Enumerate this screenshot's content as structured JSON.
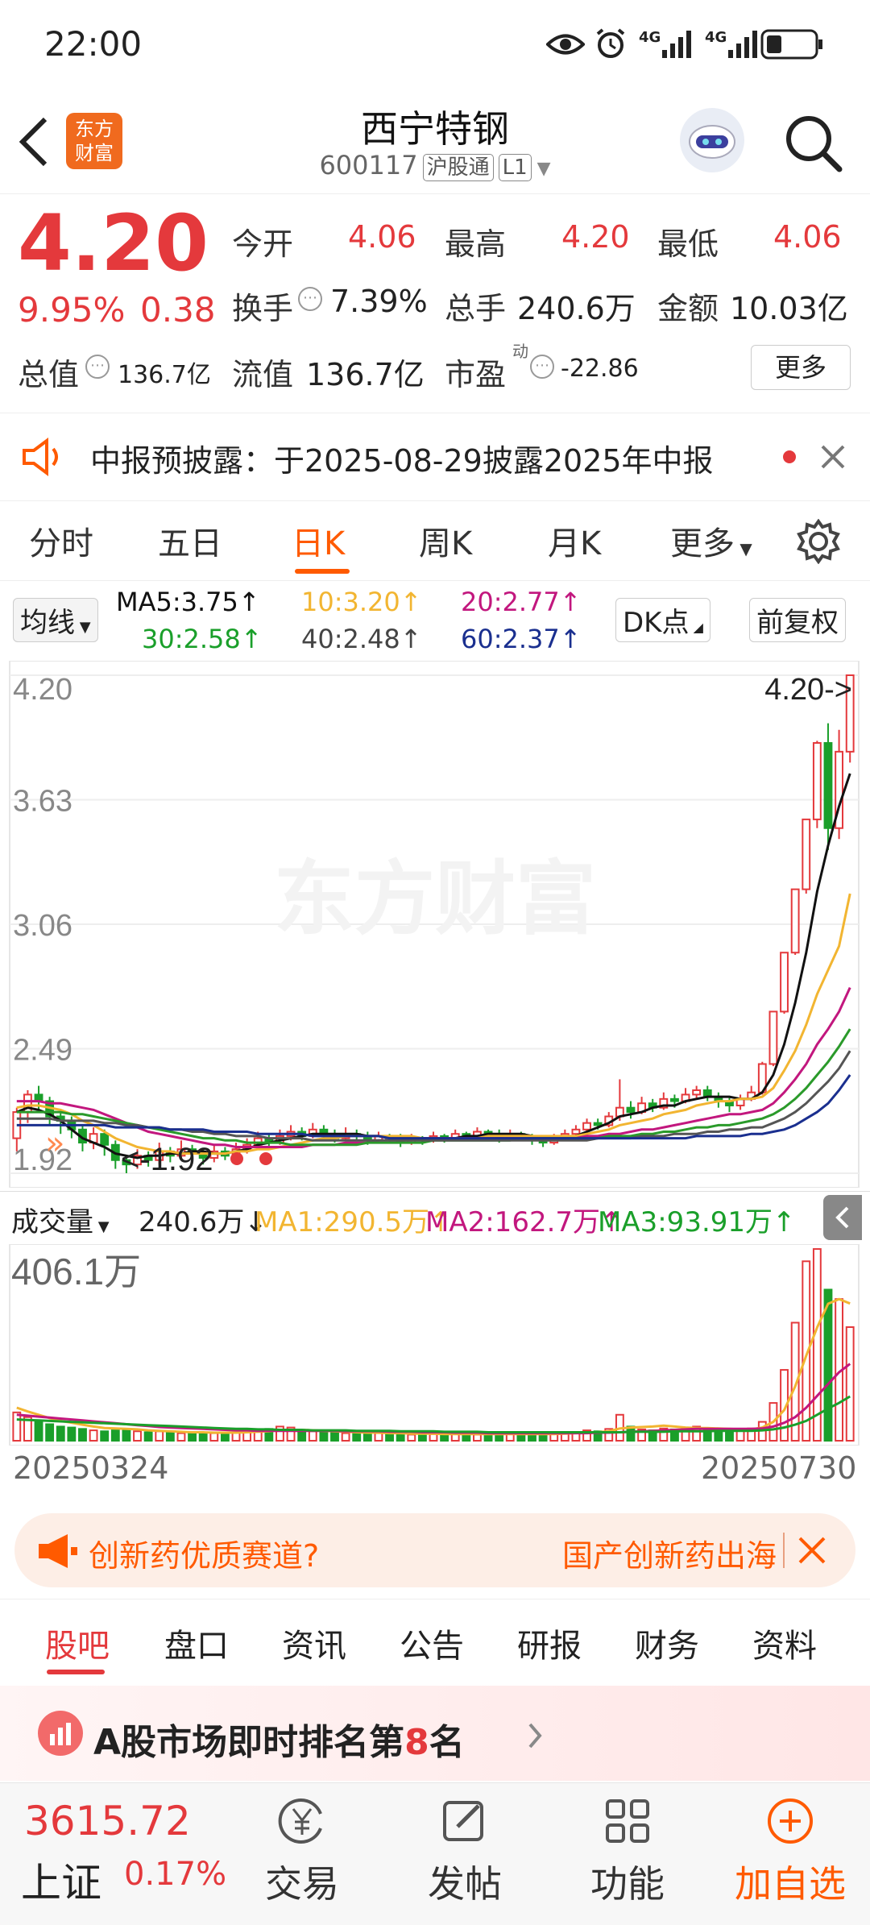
{
  "status_bar": {
    "time": "22:00",
    "net1": "4G",
    "net2": "4G"
  },
  "header": {
    "title": "西宁特钢",
    "code": "600117",
    "tag1": "沪股通",
    "tag2": "L1",
    "logo_line1": "东方",
    "logo_line2": "财富"
  },
  "quote": {
    "price": "4.20",
    "pct": "9.95%",
    "change": "0.38",
    "open_label": "今开",
    "open": "4.06",
    "high_label": "最高",
    "high": "4.20",
    "low_label": "最低",
    "low": "4.06",
    "turnover_label": "换手",
    "turnover": "7.39%",
    "volume_label": "总手",
    "volume": "240.6万",
    "amount_label": "金额",
    "amount": "10.03亿",
    "mktcap_label": "总值",
    "mktcap": "136.7亿",
    "float_label": "流值",
    "float": "136.7亿",
    "pe_label": "市盈",
    "pe_sup": "动",
    "pe": "-22.86",
    "more": "更多"
  },
  "notice": {
    "text": "中报预披露：于2025-08-29披露2025年中报"
  },
  "ktabs": [
    "分时",
    "五日",
    "日K",
    "周K",
    "月K",
    "更多"
  ],
  "ma": {
    "select": "均线",
    "ma5": "MA5:3.75↑",
    "ma10": "10:3.20↑",
    "ma20": "20:2.77↑",
    "ma30": "30:2.58↑",
    "ma40": "40:2.48↑",
    "ma60": "60:2.37↑",
    "dk": "DK点",
    "fq": "前复权"
  },
  "chart_data": {
    "type": "candlestick",
    "y_ticks": [
      "4.20",
      "3.63",
      "3.06",
      "2.49",
      "1.92"
    ],
    "ylim": [
      1.92,
      4.2
    ],
    "high_marker": "4.20->",
    "low_marker": "<-1.92",
    "watermark": "东方财富",
    "series": [
      {
        "name": "MA5",
        "color": "#111111"
      },
      {
        "name": "MA10",
        "color": "#f2b531"
      },
      {
        "name": "MA20",
        "color": "#c2177e"
      },
      {
        "name": "MA30",
        "color": "#2a9a2a"
      },
      {
        "name": "MA40",
        "color": "#555555"
      },
      {
        "name": "MA60",
        "color": "#1a2f8f"
      }
    ],
    "candles": [
      [
        2.08,
        2.2,
        2.22,
        2.02
      ],
      [
        2.2,
        2.28,
        2.3,
        2.15
      ],
      [
        2.28,
        2.25,
        2.32,
        2.2
      ],
      [
        2.25,
        2.18,
        2.27,
        2.14
      ],
      [
        2.18,
        2.16,
        2.2,
        2.1
      ],
      [
        2.16,
        2.12,
        2.18,
        2.08
      ],
      [
        2.12,
        2.06,
        2.14,
        2.02
      ],
      [
        2.06,
        2.1,
        2.13,
        2.03
      ],
      [
        2.1,
        2.05,
        2.12,
        2.0
      ],
      [
        2.05,
        1.98,
        2.07,
        1.94
      ],
      [
        1.98,
        1.96,
        2.0,
        1.92
      ],
      [
        1.96,
        2.0,
        2.03,
        1.94
      ],
      [
        2.0,
        1.98,
        2.02,
        1.95
      ],
      [
        1.98,
        2.02,
        2.06,
        1.96
      ],
      [
        2.02,
        2.0,
        2.04,
        1.97
      ],
      [
        2.0,
        2.03,
        2.07,
        1.98
      ],
      [
        2.03,
        2.01,
        2.05,
        1.99
      ],
      [
        2.01,
        1.99,
        2.03,
        1.96
      ],
      [
        1.99,
        2.02,
        2.05,
        1.97
      ],
      [
        2.02,
        2.0,
        2.04,
        1.98
      ],
      [
        2.0,
        2.03,
        2.06,
        1.99
      ],
      [
        2.03,
        2.05,
        2.08,
        2.01
      ],
      [
        2.05,
        2.08,
        2.11,
        2.03
      ],
      [
        2.08,
        2.06,
        2.1,
        2.04
      ],
      [
        2.06,
        2.09,
        2.12,
        2.05
      ],
      [
        2.09,
        2.11,
        2.14,
        2.07
      ],
      [
        2.11,
        2.09,
        2.13,
        2.07
      ],
      [
        2.09,
        2.12,
        2.15,
        2.08
      ],
      [
        2.12,
        2.1,
        2.14,
        2.08
      ],
      [
        2.1,
        2.08,
        2.12,
        2.06
      ],
      [
        2.08,
        2.1,
        2.13,
        2.07
      ],
      [
        2.1,
        2.09,
        2.12,
        2.07
      ],
      [
        2.09,
        2.07,
        2.11,
        2.05
      ],
      [
        2.07,
        2.09,
        2.11,
        2.06
      ],
      [
        2.09,
        2.08,
        2.1,
        2.06
      ],
      [
        2.08,
        2.06,
        2.1,
        2.04
      ],
      [
        2.06,
        2.08,
        2.1,
        2.05
      ],
      [
        2.08,
        2.07,
        2.09,
        2.05
      ],
      [
        2.07,
        2.09,
        2.11,
        2.06
      ],
      [
        2.09,
        2.08,
        2.1,
        2.06
      ],
      [
        2.08,
        2.1,
        2.12,
        2.07
      ],
      [
        2.1,
        2.09,
        2.11,
        2.07
      ],
      [
        2.09,
        2.11,
        2.13,
        2.08
      ],
      [
        2.11,
        2.1,
        2.12,
        2.08
      ],
      [
        2.1,
        2.08,
        2.12,
        2.06
      ],
      [
        2.08,
        2.1,
        2.12,
        2.07
      ],
      [
        2.1,
        2.09,
        2.11,
        2.07
      ],
      [
        2.09,
        2.07,
        2.1,
        2.05
      ],
      [
        2.07,
        2.06,
        2.09,
        2.04
      ],
      [
        2.06,
        2.08,
        2.1,
        2.05
      ],
      [
        2.08,
        2.1,
        2.12,
        2.07
      ],
      [
        2.1,
        2.12,
        2.14,
        2.09
      ],
      [
        2.12,
        2.15,
        2.17,
        2.11
      ],
      [
        2.15,
        2.14,
        2.17,
        2.12
      ],
      [
        2.14,
        2.18,
        2.2,
        2.13
      ],
      [
        2.18,
        2.22,
        2.35,
        2.16
      ],
      [
        2.22,
        2.2,
        2.25,
        2.17
      ],
      [
        2.2,
        2.24,
        2.27,
        2.19
      ],
      [
        2.24,
        2.22,
        2.26,
        2.2
      ],
      [
        2.22,
        2.26,
        2.29,
        2.21
      ],
      [
        2.26,
        2.25,
        2.28,
        2.22
      ],
      [
        2.25,
        2.28,
        2.31,
        2.24
      ],
      [
        2.28,
        2.3,
        2.32,
        2.26
      ],
      [
        2.3,
        2.27,
        2.32,
        2.25
      ],
      [
        2.27,
        2.25,
        2.29,
        2.22
      ],
      [
        2.25,
        2.23,
        2.27,
        2.2
      ],
      [
        2.23,
        2.26,
        2.28,
        2.21
      ],
      [
        2.26,
        2.29,
        2.32,
        2.25
      ],
      [
        2.29,
        2.42,
        2.43,
        2.28
      ],
      [
        2.42,
        2.66,
        2.66,
        2.41
      ],
      [
        2.66,
        2.93,
        2.93,
        2.65
      ],
      [
        2.93,
        3.22,
        3.22,
        2.92
      ],
      [
        3.22,
        3.54,
        3.54,
        3.2
      ],
      [
        3.54,
        3.89,
        3.9,
        3.5
      ],
      [
        3.89,
        3.5,
        3.98,
        3.4
      ],
      [
        3.5,
        3.85,
        3.95,
        3.45
      ],
      [
        3.85,
        4.2,
        4.2,
        3.8
      ]
    ],
    "ma_values": {
      "MA5": [
        2.2,
        2.22,
        2.21,
        2.19,
        2.16,
        2.12,
        2.08,
        2.06,
        2.04,
        2.01,
        2.0,
        1.99,
        2.0,
        2.0,
        2.01,
        2.01,
        2.02,
        2.02,
        2.01,
        2.01,
        2.02,
        2.03,
        2.05,
        2.06,
        2.07,
        2.08,
        2.09,
        2.1,
        2.1,
        2.1,
        2.1,
        2.1,
        2.09,
        2.09,
        2.08,
        2.08,
        2.08,
        2.07,
        2.08,
        2.08,
        2.08,
        2.09,
        2.09,
        2.1,
        2.1,
        2.1,
        2.1,
        2.09,
        2.08,
        2.08,
        2.08,
        2.09,
        2.11,
        2.13,
        2.15,
        2.18,
        2.19,
        2.2,
        2.22,
        2.23,
        2.23,
        2.25,
        2.26,
        2.27,
        2.27,
        2.27,
        2.26,
        2.26,
        2.29,
        2.37,
        2.51,
        2.7,
        2.93,
        3.21,
        3.42,
        3.6,
        3.75
      ],
      "MA10": [
        2.22,
        2.23,
        2.23,
        2.22,
        2.21,
        2.19,
        2.16,
        2.14,
        2.11,
        2.08,
        2.06,
        2.04,
        2.03,
        2.02,
        2.02,
        2.01,
        2.01,
        2.01,
        2.01,
        2.01,
        2.02,
        2.02,
        2.03,
        2.03,
        2.04,
        2.05,
        2.06,
        2.07,
        2.08,
        2.08,
        2.09,
        2.09,
        2.09,
        2.09,
        2.09,
        2.09,
        2.09,
        2.08,
        2.08,
        2.08,
        2.08,
        2.08,
        2.08,
        2.09,
        2.09,
        2.09,
        2.09,
        2.09,
        2.09,
        2.09,
        2.09,
        2.09,
        2.1,
        2.11,
        2.12,
        2.14,
        2.15,
        2.16,
        2.17,
        2.19,
        2.2,
        2.21,
        2.23,
        2.24,
        2.25,
        2.25,
        2.26,
        2.26,
        2.27,
        2.31,
        2.39,
        2.48,
        2.6,
        2.74,
        2.85,
        2.96,
        3.2
      ],
      "MA20": [
        2.25,
        2.25,
        2.25,
        2.24,
        2.24,
        2.23,
        2.22,
        2.21,
        2.19,
        2.17,
        2.15,
        2.13,
        2.11,
        2.1,
        2.09,
        2.08,
        2.07,
        2.06,
        2.05,
        2.05,
        2.04,
        2.04,
        2.04,
        2.04,
        2.04,
        2.04,
        2.04,
        2.05,
        2.05,
        2.05,
        2.06,
        2.06,
        2.06,
        2.07,
        2.07,
        2.07,
        2.07,
        2.08,
        2.08,
        2.08,
        2.08,
        2.08,
        2.08,
        2.08,
        2.08,
        2.08,
        2.08,
        2.08,
        2.08,
        2.08,
        2.08,
        2.08,
        2.09,
        2.09,
        2.1,
        2.1,
        2.11,
        2.12,
        2.12,
        2.13,
        2.14,
        2.15,
        2.16,
        2.17,
        2.18,
        2.19,
        2.19,
        2.2,
        2.21,
        2.24,
        2.29,
        2.35,
        2.42,
        2.51,
        2.58,
        2.66,
        2.77
      ],
      "MA30": [
        2.2,
        2.2,
        2.2,
        2.2,
        2.2,
        2.19,
        2.19,
        2.18,
        2.17,
        2.16,
        2.15,
        2.14,
        2.13,
        2.12,
        2.11,
        2.1,
        2.09,
        2.08,
        2.08,
        2.07,
        2.07,
        2.06,
        2.06,
        2.06,
        2.06,
        2.05,
        2.05,
        2.05,
        2.05,
        2.05,
        2.05,
        2.05,
        2.06,
        2.06,
        2.06,
        2.06,
        2.06,
        2.06,
        2.07,
        2.07,
        2.07,
        2.07,
        2.07,
        2.07,
        2.07,
        2.07,
        2.08,
        2.08,
        2.08,
        2.08,
        2.08,
        2.08,
        2.08,
        2.08,
        2.09,
        2.09,
        2.09,
        2.1,
        2.1,
        2.11,
        2.11,
        2.12,
        2.13,
        2.13,
        2.14,
        2.14,
        2.15,
        2.16,
        2.17,
        2.19,
        2.22,
        2.26,
        2.31,
        2.37,
        2.43,
        2.5,
        2.58
      ],
      "MA40": [
        2.17,
        2.17,
        2.17,
        2.17,
        2.16,
        2.16,
        2.16,
        2.16,
        2.15,
        2.15,
        2.14,
        2.14,
        2.13,
        2.13,
        2.12,
        2.12,
        2.11,
        2.11,
        2.1,
        2.1,
        2.09,
        2.09,
        2.09,
        2.08,
        2.08,
        2.08,
        2.08,
        2.07,
        2.07,
        2.07,
        2.07,
        2.07,
        2.07,
        2.07,
        2.07,
        2.07,
        2.07,
        2.07,
        2.07,
        2.07,
        2.07,
        2.07,
        2.07,
        2.07,
        2.07,
        2.07,
        2.07,
        2.07,
        2.07,
        2.07,
        2.07,
        2.07,
        2.07,
        2.08,
        2.08,
        2.08,
        2.08,
        2.09,
        2.09,
        2.09,
        2.1,
        2.1,
        2.1,
        2.11,
        2.11,
        2.12,
        2.12,
        2.13,
        2.13,
        2.15,
        2.17,
        2.2,
        2.24,
        2.29,
        2.34,
        2.4,
        2.48
      ],
      "MA60": [
        2.14,
        2.14,
        2.14,
        2.14,
        2.14,
        2.14,
        2.14,
        2.14,
        2.14,
        2.13,
        2.13,
        2.13,
        2.13,
        2.13,
        2.12,
        2.12,
        2.12,
        2.12,
        2.11,
        2.11,
        2.11,
        2.11,
        2.1,
        2.1,
        2.1,
        2.1,
        2.1,
        2.09,
        2.09,
        2.09,
        2.09,
        2.09,
        2.09,
        2.09,
        2.08,
        2.08,
        2.08,
        2.08,
        2.08,
        2.08,
        2.08,
        2.08,
        2.08,
        2.08,
        2.08,
        2.08,
        2.08,
        2.08,
        2.08,
        2.08,
        2.08,
        2.08,
        2.08,
        2.08,
        2.08,
        2.08,
        2.08,
        2.08,
        2.08,
        2.08,
        2.08,
        2.08,
        2.09,
        2.09,
        2.09,
        2.09,
        2.09,
        2.1,
        2.1,
        2.11,
        2.12,
        2.14,
        2.17,
        2.2,
        2.24,
        2.3,
        2.37
      ]
    },
    "volume": {
      "label": "成交量",
      "value": "240.6万↓",
      "ma1": "MA1:290.5万↑",
      "ma2": "MA2:162.7万↑",
      "ma3": "MA3:93.91万↑",
      "max_label": "406.1万",
      "max": 406.1,
      "bars": [
        60,
        50,
        40,
        35,
        30,
        28,
        25,
        22,
        20,
        22,
        24,
        20,
        18,
        20,
        18,
        16,
        15,
        17,
        16,
        15,
        18,
        20,
        22,
        25,
        30,
        28,
        22,
        20,
        18,
        17,
        16,
        15,
        14,
        16,
        15,
        14,
        13,
        15,
        14,
        13,
        14,
        15,
        13,
        14,
        15,
        14,
        13,
        12,
        14,
        15,
        16,
        18,
        22,
        20,
        25,
        55,
        30,
        24,
        22,
        26,
        24,
        28,
        30,
        26,
        22,
        20,
        22,
        26,
        40,
        80,
        150,
        250,
        380,
        406,
        320,
        300,
        240.6
      ],
      "ma1_values": [
        70,
        62,
        55,
        48,
        42,
        38,
        34,
        30,
        27,
        26,
        25,
        24,
        22,
        21,
        20,
        19,
        18,
        18,
        17,
        17,
        17,
        18,
        19,
        20,
        22,
        23,
        23,
        22,
        21,
        20,
        19,
        18,
        17,
        17,
        16,
        16,
        15,
        15,
        15,
        14,
        14,
        14,
        14,
        14,
        14,
        14,
        14,
        14,
        14,
        14,
        15,
        16,
        17,
        18,
        20,
        26,
        28,
        29,
        30,
        32,
        30,
        28,
        27,
        27,
        26,
        25,
        24,
        24,
        28,
        40,
        65,
        115,
        180,
        240,
        290,
        300,
        290.5
      ],
      "ma2_values": [
        55,
        53,
        51,
        49,
        47,
        45,
        43,
        41,
        39,
        37,
        35,
        33,
        31,
        29,
        28,
        27,
        26,
        25,
        24,
        23,
        22,
        22,
        21,
        21,
        21,
        21,
        21,
        21,
        21,
        21,
        20,
        20,
        20,
        20,
        19,
        19,
        19,
        18,
        18,
        18,
        17,
        17,
        17,
        16,
        16,
        16,
        16,
        16,
        16,
        16,
        16,
        16,
        16,
        17,
        17,
        18,
        19,
        20,
        21,
        22,
        23,
        24,
        25,
        25,
        25,
        25,
        25,
        25,
        26,
        30,
        38,
        50,
        70,
        95,
        120,
        145,
        162.7
      ],
      "ma3_values": [
        45,
        44,
        43,
        42,
        41,
        40,
        39,
        38,
        37,
        36,
        35,
        34,
        33,
        32,
        31,
        30,
        29,
        28,
        27,
        26,
        25,
        25,
        24,
        24,
        23,
        23,
        23,
        22,
        22,
        22,
        22,
        21,
        21,
        21,
        21,
        20,
        20,
        20,
        20,
        19,
        19,
        19,
        19,
        18,
        18,
        18,
        18,
        18,
        18,
        18,
        18,
        18,
        18,
        18,
        18,
        18,
        19,
        19,
        19,
        19,
        20,
        20,
        20,
        20,
        21,
        21,
        21,
        21,
        22,
        24,
        28,
        34,
        42,
        55,
        68,
        80,
        93.91
      ]
    },
    "x_start": "20250324",
    "x_end": "20250730"
  },
  "ad": {
    "left": "创新药优质赛道?",
    "right": "国产创新药出海"
  },
  "bottom_tabs": [
    "股吧",
    "盘口",
    "资讯",
    "公告",
    "研报",
    "财务",
    "资料"
  ],
  "rank": {
    "text_before": "A股市场即时排名第",
    "rank": "8",
    "text_after": "名"
  },
  "bottom_bar": {
    "index_value": "3615.72",
    "index_name": "上证",
    "index_pct": "0.17%",
    "trade": "交易",
    "post": "发帖",
    "func": "功能",
    "add": "加自选"
  },
  "colors": {
    "up": "#e4393c",
    "down": "#1a9f2a",
    "accent": "#ff5a00"
  }
}
